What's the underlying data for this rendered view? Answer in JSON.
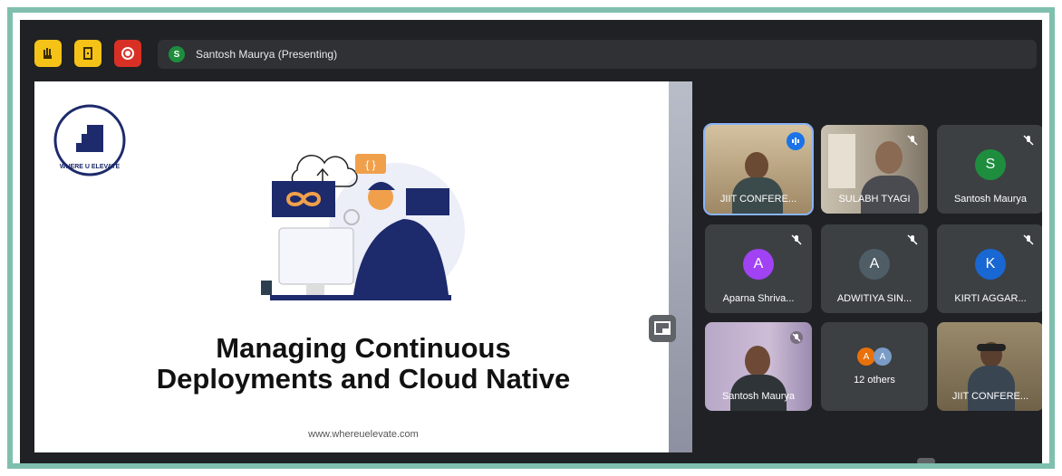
{
  "toolbar": {
    "presenter_initial": "S",
    "presenting_text": "Santosh Maurya (Presenting)"
  },
  "slide": {
    "logo_text": "WHERE U ELEVATE",
    "title_line1": "Managing Continuous",
    "title_line2": "Deployments and Cloud Native",
    "url": "www.whereuelevate.com",
    "code_badge": "{ }"
  },
  "participants": [
    {
      "name": "JIIT CONFERE...",
      "type": "video",
      "speaking": true
    },
    {
      "name": "SULABH TYAGI",
      "type": "video",
      "muted": true
    },
    {
      "name": "Santosh Maurya",
      "type": "avatar",
      "initial": "S",
      "color": "#1e8e3e",
      "muted": true
    },
    {
      "name": "Aparna Shriva...",
      "type": "avatar",
      "initial": "A",
      "color": "#a142f4",
      "muted": true
    },
    {
      "name": "ADWITIYA SIN...",
      "type": "avatar",
      "initial": "A",
      "color": "#4e5d66",
      "muted": true
    },
    {
      "name": "KIRTI AGGAR...",
      "type": "avatar",
      "initial": "K",
      "color": "#1967d2",
      "muted": true
    },
    {
      "name": "Santosh Maurya",
      "type": "video",
      "muted": true
    },
    {
      "name": "12 others",
      "type": "others",
      "initials": [
        "A",
        "A"
      ],
      "colors": [
        "#e8710a",
        "#7a9cc6"
      ]
    },
    {
      "name": "JIIT CONFERE...",
      "type": "video"
    }
  ],
  "colors": {
    "background": "#202124",
    "frame": "#7fbfae",
    "tile": "#3c4043",
    "accent_yellow": "#f5c218",
    "accent_red": "#d93025"
  }
}
